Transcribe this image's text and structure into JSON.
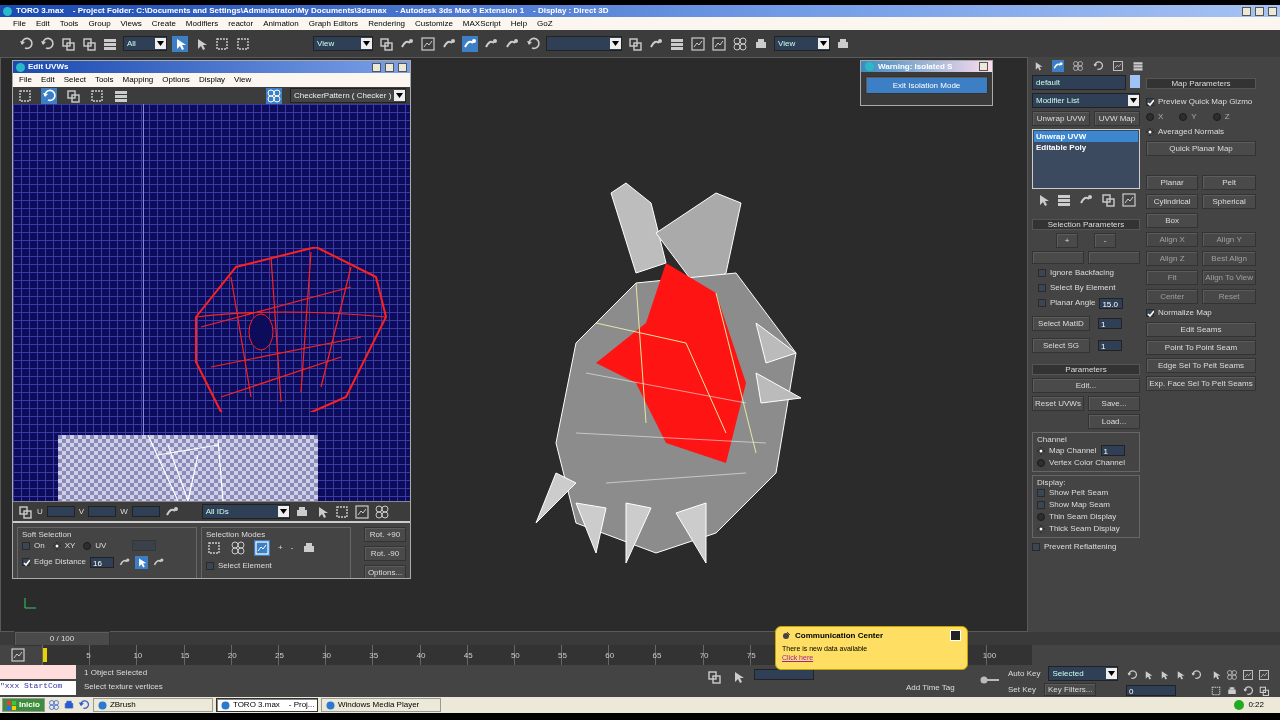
{
  "window": {
    "title": "TORO 3.max    - Project Folder: C:\\Documents and Settings\\Administrator\\My Documents\\3dsmax    - Autodesk 3ds Max 9 Extension 1    - Display : Direct 3D"
  },
  "menu": [
    "File",
    "Edit",
    "Tools",
    "Group",
    "Views",
    "Create",
    "Modifiers",
    "reactor",
    "Animation",
    "Graph Editors",
    "Rendering",
    "Customize",
    "MAXScript",
    "Help",
    "GoZ"
  ],
  "toolbar": {
    "selection_filter": "All",
    "reference_coord": "View",
    "view_dropdown": "View"
  },
  "uvw_editor": {
    "title": "Edit UVWs",
    "menu": [
      "File",
      "Edit",
      "Select",
      "Tools",
      "Mapping",
      "Options",
      "Display",
      "View"
    ],
    "texture": "CheckerPattern  ( Checker )",
    "u_label": "U",
    "v_label": "V",
    "w_label": "W",
    "ids": "All IDs",
    "soft_selection": {
      "title": "Soft Selection",
      "on": {
        "label": "On",
        "checked": false
      },
      "xy": {
        "label": "XY",
        "selected": true
      },
      "uv": {
        "label": "UV",
        "selected": false
      },
      "edge_distance": {
        "label": "Edge Distance",
        "checked": true,
        "value": "16"
      }
    },
    "selection_modes": {
      "title": "Selection Modes",
      "modes": [
        {
          "kind": "vertex",
          "selected": false
        },
        {
          "kind": "edge",
          "selected": false
        },
        {
          "kind": "face",
          "selected": true
        }
      ],
      "plus": "+",
      "minus": "-",
      "select_element": {
        "label": "Select Element",
        "checked": false
      }
    },
    "buttons": [
      "Rot. +90",
      "Rot. -90",
      "Options..."
    ]
  },
  "warning": {
    "title": "Warning: Isolated S",
    "button": "Exit Isolation Mode"
  },
  "command_panel": {
    "object_name": "default",
    "modifier_list": "Modifier List",
    "buttons": [
      "Unwrap UVW",
      "UVW Map"
    ],
    "stack": [
      {
        "label": "Unwrap UVW",
        "selected": true
      },
      {
        "label": "Editable Poly",
        "selected": false
      }
    ],
    "selection_parameters": {
      "title": "Selection Parameters",
      "plus": "+",
      "minus": "-",
      "options": [
        {
          "label": "Ignore Backfacing",
          "checked": false
        },
        {
          "label": "Select By Element",
          "checked": false
        },
        {
          "label": "Planar Angle",
          "checked": false
        }
      ],
      "planar_angle": "15.0",
      "select_matid": "Select MatID",
      "matid": "1",
      "select_sg": "Select SG",
      "sg": "1"
    },
    "parameters": {
      "title": "Parameters",
      "edit": "Edit...",
      "reset": "Reset UVWs",
      "save": "Save...",
      "load": "Load...",
      "channel_title": "Channel",
      "channels": [
        {
          "label": "Map Channel",
          "selected": true
        },
        {
          "label": "Vertex Color Channel",
          "selected": false
        }
      ],
      "map_channel": "1",
      "display_title": "Display:",
      "seams": [
        {
          "label": "Show Pelt Seam",
          "checked": false
        },
        {
          "label": "Show Map Seam",
          "checked": false
        }
      ],
      "seam_display": [
        {
          "label": "Thin Seam Display",
          "selected": false
        },
        {
          "label": "Thick Seam Display",
          "selected": true
        }
      ],
      "prevent": {
        "label": "Prevent Reflattening",
        "checked": false
      }
    }
  },
  "map_parameters": {
    "title": "Map Parameters",
    "preview": {
      "label": "Preview Quick Map Gizmo",
      "checked": true
    },
    "axes": [
      {
        "label": "X",
        "selected": false
      },
      {
        "label": "Y",
        "selected": false
      },
      {
        "label": "Z",
        "selected": false
      }
    ],
    "averaged": {
      "label": "Averaged Normals",
      "selected": true
    },
    "quick_planar": "Quick Planar Map",
    "map_buttons": [
      {
        "label": "Planar",
        "disabled": false
      },
      {
        "label": "Pelt",
        "disabled": false
      },
      {
        "label": "Cylindrical",
        "disabled": false
      },
      {
        "label": "Spherical",
        "disabled": false
      },
      {
        "label": "Box",
        "disabled": false
      }
    ],
    "align_buttons": [
      {
        "label": "Align X",
        "disabled": true
      },
      {
        "label": "Align Y",
        "disabled": true
      },
      {
        "label": "Align Z",
        "disabled": true
      },
      {
        "label": "Best Align",
        "disabled": true
      },
      {
        "label": "Fit",
        "disabled": true
      },
      {
        "label": "Align To View",
        "disabled": true
      },
      {
        "label": "Center",
        "disabled": true
      },
      {
        "label": "Reset",
        "disabled": true
      }
    ],
    "normalize": {
      "label": "Normalize Map",
      "checked": true
    },
    "seam_buttons": [
      "Edit Seams",
      "Point To Point Seam",
      "Edge Sel To Pelt Seams",
      "Exp. Face Sel To Pelt Seams"
    ]
  },
  "timeline": {
    "frame": "0 / 100",
    "ticks": [
      "5",
      "10",
      "15",
      "20",
      "25",
      "30",
      "35",
      "40",
      "45",
      "50",
      "55",
      "60",
      "65",
      "70",
      "75"
    ],
    "end_tick": "100",
    "level": 0.0
  },
  "status": {
    "selected": "1 Object Selected",
    "prompt": "Select texture vertices",
    "maxscript": "\"xxx StartCom",
    "add_time_tag": "Add Time Tag",
    "auto_key": "Auto Key",
    "set_key": "Set Key",
    "key_mode": "Selected",
    "key_filters": "Key Filters...",
    "frame_field": "0"
  },
  "communication": {
    "title": "Communication Center",
    "message": "There is new data available",
    "link": "Click here"
  },
  "taskbar": {
    "start": "Inicio",
    "tasks": [
      {
        "label": "ZBrush",
        "selected": false
      },
      {
        "label": "TORO 3.max    - Proj...",
        "selected": true
      },
      {
        "label": "Windows Media Player",
        "selected": false
      }
    ],
    "clock": "0:22"
  }
}
